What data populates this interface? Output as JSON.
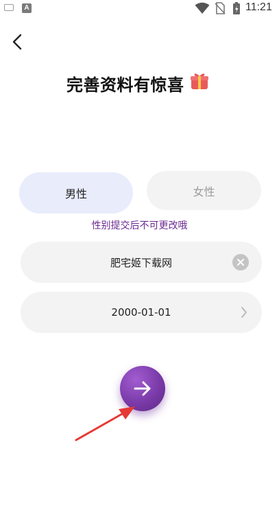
{
  "status_bar": {
    "time": "11:21",
    "keyboard_icon": "keyboard-icon",
    "a_icon_label": "A",
    "wifi_icon": "wifi-icon",
    "sim_icon": "no-sim-icon",
    "battery_icon": "battery-charging-icon"
  },
  "header": {
    "back_icon": "chevron-left-icon",
    "title": "完善资料有惊喜",
    "title_icon": "gift-icon"
  },
  "gender": {
    "male_label": "男性",
    "female_label": "女性",
    "selected": "男性",
    "notice": "性别提交后不可更改哦"
  },
  "form": {
    "nickname_value": "肥宅姬下载网",
    "clear_icon": "clear-icon",
    "birthday_value": "2000-01-01",
    "chevron_icon": "chevron-right-icon"
  },
  "next": {
    "icon": "arrow-right-icon"
  },
  "colors": {
    "accent": "#7a3aa8",
    "notice": "#6b2b91",
    "male_bg": "#e9ecfb",
    "field_bg": "#f3f3f3",
    "annotation_arrow": "#e53935"
  }
}
